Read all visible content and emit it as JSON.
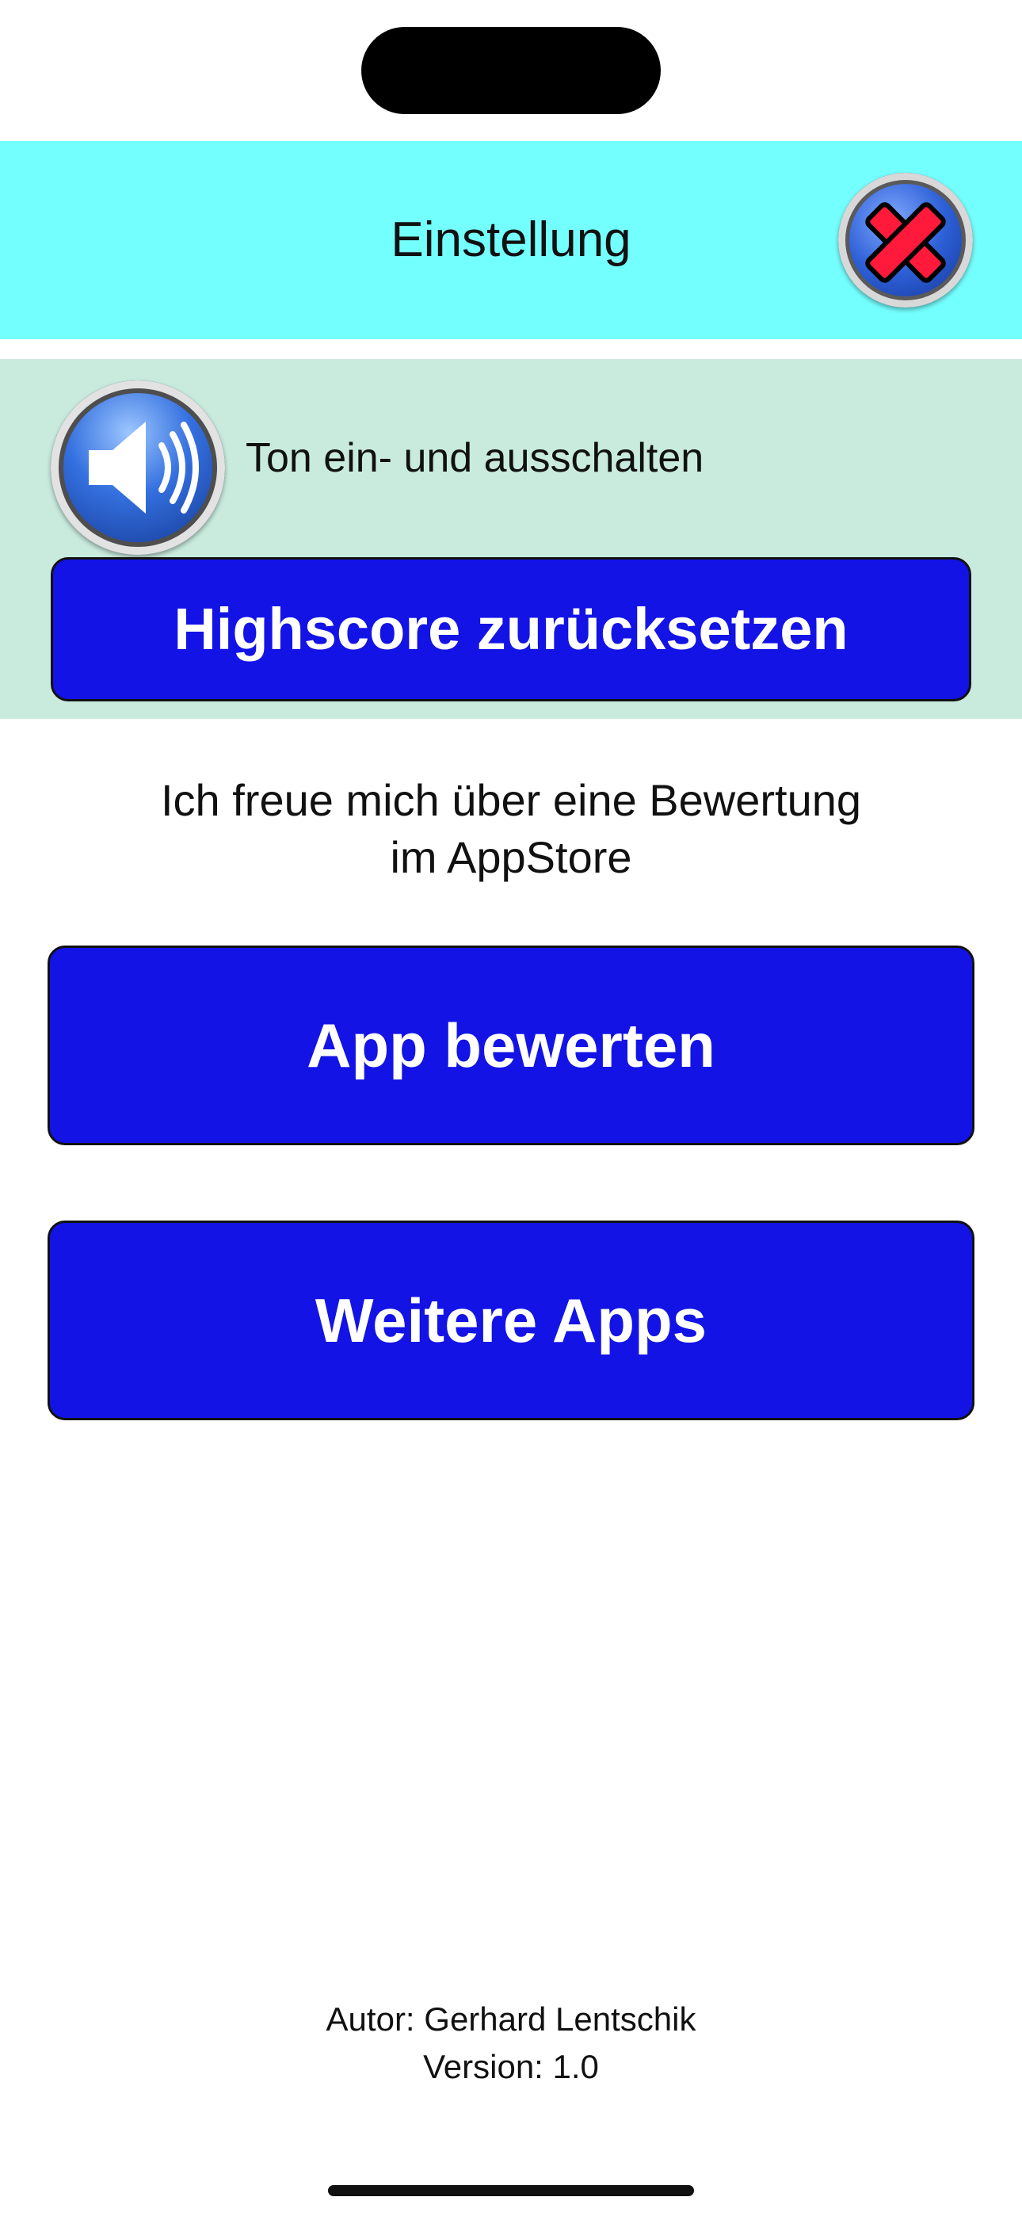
{
  "header": {
    "title": "Einstellung",
    "close_icon": "close-x-icon"
  },
  "settings": {
    "sound_icon": "speaker-icon",
    "sound_label": "Ton ein- und ausschalten",
    "reset_highscore_label": "Highscore zurücksetzen"
  },
  "rating": {
    "line1": "Ich freue mich über eine Bewertung",
    "line2": "im AppStore",
    "rate_app_label": "App bewerten",
    "more_apps_label": "Weitere Apps"
  },
  "footer": {
    "author": "Autor: Gerhard Lentschik",
    "version": "Version: 1.0"
  },
  "colors": {
    "header_bg": "#74ffff",
    "panel_bg": "#c9ebde",
    "button_bg": "#1313e6",
    "close_x": "#ff1a3c"
  }
}
